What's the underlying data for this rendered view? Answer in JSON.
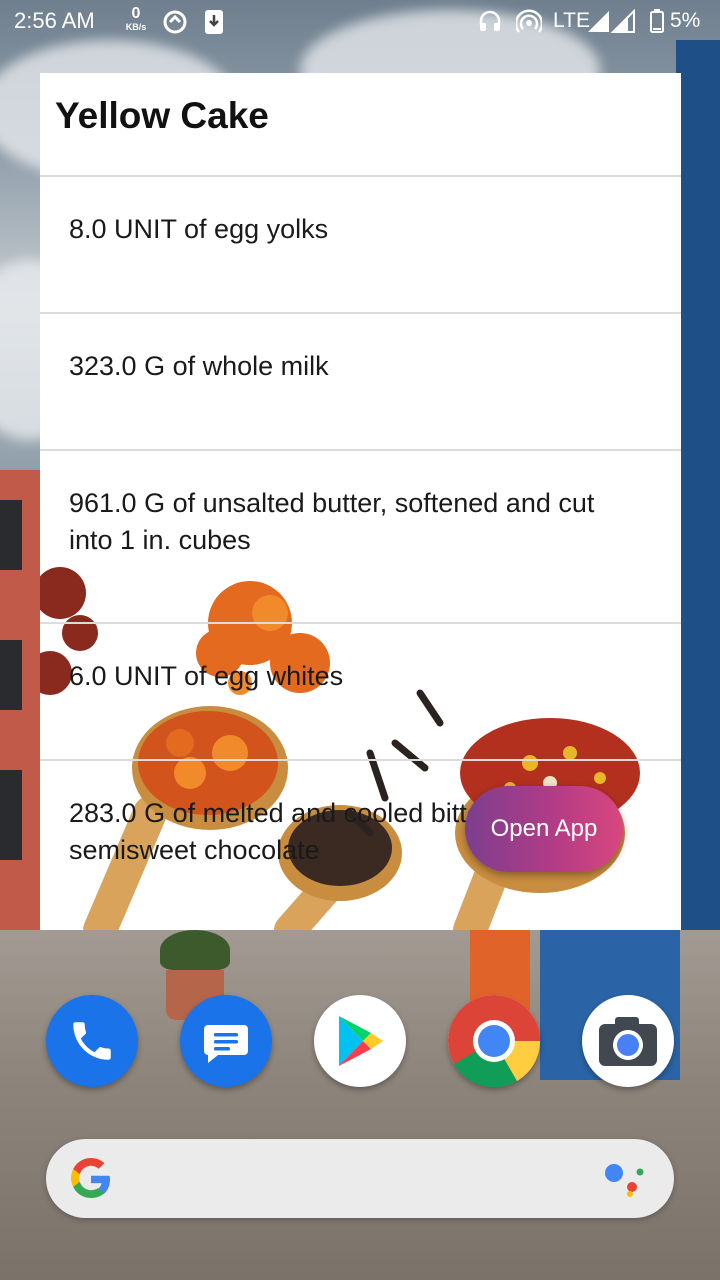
{
  "status_bar": {
    "time": "2:56 AM",
    "speed_value": "0",
    "speed_unit": "KB/s",
    "network": "LTE",
    "battery": "5%"
  },
  "widget": {
    "title": "Yellow Cake",
    "ingredients": [
      "8.0 UNIT of egg yolks",
      "323.0 G of whole milk",
      "961.0 G of unsalted butter, softened and cut into 1 in. cubes",
      "6.0 UNIT of egg whites",
      "283.0 G of melted and cooled bittersweet or semisweet chocolate"
    ],
    "open_app_label": "Open App"
  },
  "dock": {
    "apps": [
      "phone-icon",
      "messages-icon",
      "play-store-icon",
      "chrome-icon",
      "camera-icon"
    ]
  },
  "colors": {
    "button_gradient_start": "#7b3f8e",
    "button_gradient_end": "#d8477e",
    "phone_blue": "#1a73e8"
  }
}
